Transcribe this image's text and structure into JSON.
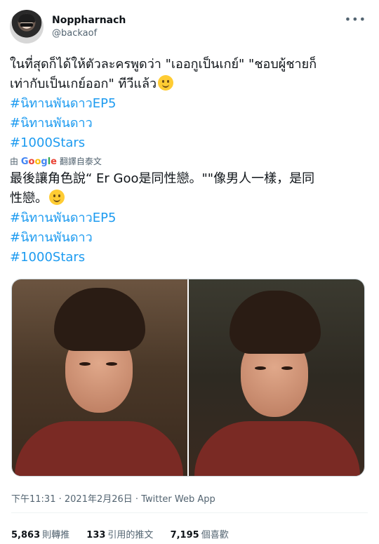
{
  "author": {
    "name": "Noppharnach",
    "handle": "@backaof"
  },
  "more_icon": "more-horizontal-icon",
  "tweet": {
    "text_line1": "ในที่สุดก็ได้ให้ตัวละครพูดว่า \"เออกูเป็นเกย์\" \"ชอบผู้ชายก็",
    "text_line2": "เท่ากับเป็นเกย์ออก\" ทีวีแล้ว",
    "emoji": "slightly-smiling-face-icon",
    "hashtags": [
      "#นิทานพันดาวEP5",
      "#นิทานพันดาว",
      "#1000Stars"
    ]
  },
  "translation": {
    "prefix": "由",
    "brand": "Google",
    "action": "翻譯自",
    "source_lang": "泰文",
    "text_line1": "最後讓角色說“ Er Goo是同性戀。\"\"像男人一樣，是同",
    "text_line2": "性戀。",
    "hashtags": [
      "#นิทานพันดาวEP5",
      "#นิทานพันดาว",
      "#1000Stars"
    ]
  },
  "meta": {
    "time": "下午11:31",
    "date": "2021年2月26日",
    "source": "Twitter Web App"
  },
  "stats": {
    "retweets_count": "5,863",
    "retweets_label": "則轉推",
    "quotes_count": "133",
    "quotes_label": "引用的推文",
    "likes_count": "7,195",
    "likes_label": "個喜歡"
  },
  "colors": {
    "link": "#1d9bf0",
    "secondary_text": "#536471"
  }
}
